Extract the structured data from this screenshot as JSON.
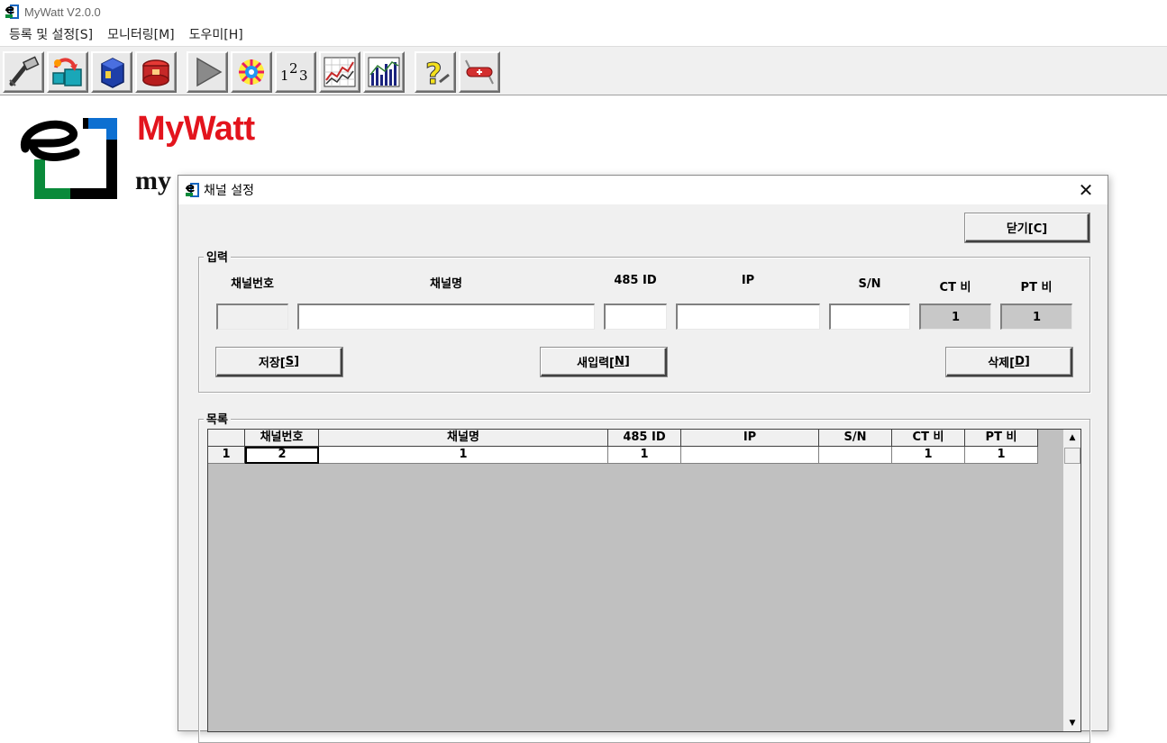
{
  "window": {
    "title": "MyWatt V2.0.0",
    "icon": "app-logo-icon"
  },
  "menu": [
    {
      "label": "등록 및 설정[S]"
    },
    {
      "label": "모니터링[M]"
    },
    {
      "label": "도우미[H]"
    }
  ],
  "toolbar": [
    {
      "icon": "connect-cable-icon"
    },
    {
      "icon": "transfer-box-icon"
    },
    {
      "icon": "blue-device-icon"
    },
    {
      "icon": "red-toolbox-icon"
    },
    {
      "icon": "play-icon"
    },
    {
      "icon": "eye-color-icon"
    },
    {
      "icon": "numbers-123-icon"
    },
    {
      "icon": "line-graph-icon"
    },
    {
      "icon": "bar-graph-icon"
    },
    {
      "icon": "help-question-icon"
    },
    {
      "icon": "exit-knife-icon"
    }
  ],
  "brand": {
    "title": "MyWatt",
    "subtitle": "my"
  },
  "dialog": {
    "title": "채널 설정",
    "close_label": "닫기[C]",
    "close_hotkey": "C",
    "input_group_label": "입력",
    "list_group_label": "목록",
    "input_headers": {
      "channel_no": "채널번호",
      "channel_name": "채널명",
      "id485": "485 ID",
      "ip": "IP",
      "sn": "S/N",
      "ct": "CT 비",
      "pt": "PT 비"
    },
    "input_values": {
      "channel_no": "",
      "channel_name": "",
      "id485": "",
      "ip": "",
      "sn": "",
      "ct": "1",
      "pt": "1"
    },
    "buttons": {
      "save_prefix": "저장[",
      "save_key": "S",
      "save_suffix": "]",
      "new_prefix": "새입력[",
      "new_key": "N",
      "new_suffix": "]",
      "delete_prefix": "삭제[",
      "delete_key": "D",
      "delete_suffix": "]"
    },
    "grid": {
      "columns": [
        "",
        "채널번호",
        "채널명",
        "485 ID",
        "IP",
        "S/N",
        "CT 비",
        "PT 비"
      ],
      "rows": [
        [
          "1",
          "2",
          "1",
          "1",
          "",
          "",
          "1",
          "1"
        ]
      ]
    }
  }
}
